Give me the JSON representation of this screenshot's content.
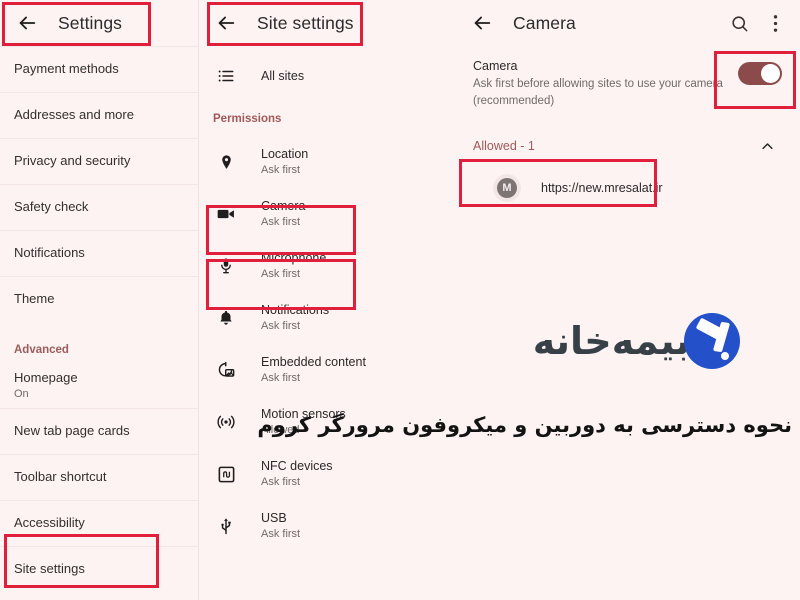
{
  "settings_panel": {
    "appbar": {
      "back_icon": "arrow-back-icon",
      "title": "Settings"
    },
    "items": [
      {
        "label": "Payment methods",
        "sub": ""
      },
      {
        "label": "Addresses and more",
        "sub": ""
      },
      {
        "label": "Privacy and security",
        "sub": ""
      },
      {
        "label": "Safety check",
        "sub": ""
      },
      {
        "label": "Notifications",
        "sub": ""
      },
      {
        "label": "Theme",
        "sub": ""
      }
    ],
    "advanced_header": "Advanced",
    "advanced_items": [
      {
        "label": "Homepage",
        "sub": "On"
      },
      {
        "label": "New tab page cards",
        "sub": ""
      },
      {
        "label": "Toolbar shortcut",
        "sub": ""
      },
      {
        "label": "Accessibility",
        "sub": ""
      },
      {
        "label": "Site settings",
        "sub": ""
      }
    ]
  },
  "site_settings_panel": {
    "appbar": {
      "back_icon": "arrow-back-icon",
      "title": "Site settings"
    },
    "all_sites": {
      "label": "All sites",
      "icon": "list-icon"
    },
    "permissions_header": "Permissions",
    "permissions": [
      {
        "icon": "location-pin-icon",
        "title": "Location",
        "sub": "Ask first"
      },
      {
        "icon": "camera-icon",
        "title": "Camera",
        "sub": "Ask first"
      },
      {
        "icon": "microphone-icon",
        "title": "Microphone",
        "sub": "Ask first"
      },
      {
        "icon": "bell-icon",
        "title": "Notifications",
        "sub": "Ask first"
      },
      {
        "icon": "embedded-content-icon",
        "title": "Embedded content",
        "sub": "Ask first"
      },
      {
        "icon": "motion-sensor-icon",
        "title": "Motion sensors",
        "sub": "Allowed"
      },
      {
        "icon": "nfc-icon",
        "title": "NFC devices",
        "sub": "Ask first"
      },
      {
        "icon": "usb-icon",
        "title": "USB",
        "sub": "Ask first"
      }
    ]
  },
  "camera_panel": {
    "appbar": {
      "back_icon": "arrow-back-icon",
      "title": "Camera",
      "search_icon": "search-icon",
      "overflow_icon": "more-vertical-icon"
    },
    "toggle": {
      "title": "Camera",
      "description": "Ask first before allowing sites to use your camera (recommended)",
      "state": "on"
    },
    "allowed": {
      "label": "Allowed - 1",
      "chevron_icon": "chevron-up-icon"
    },
    "sites": [
      {
        "avatar_letter": "M",
        "url": "https://new.mresalat.ir"
      }
    ]
  },
  "watermark": {
    "text": "بیمه‌خانه",
    "logo_icon": "bimeh-khaneh-logo"
  },
  "caption": {
    "text": "نحوه دسترسی به دوربین و میکروفون مرورگر کروم"
  },
  "colors": {
    "background": "#fdf3f2",
    "highlight_box": "#e01f3d",
    "toggle_on": "#8b4b4b",
    "accent_text": "#a05a5a",
    "logo_blue": "#2451c9"
  }
}
